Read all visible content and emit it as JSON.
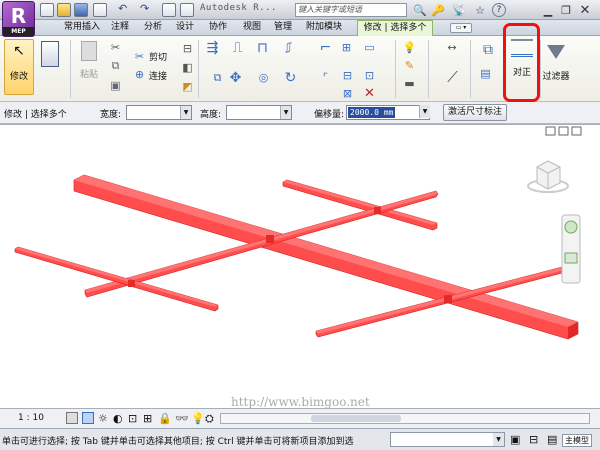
{
  "app": {
    "logo_letter": "R",
    "logo_sub": "MEP",
    "window_title": "Autodesk R...",
    "search_placeholder": "键入关键字或短语"
  },
  "tabs": [
    {
      "label": "常用"
    },
    {
      "label": "插入"
    },
    {
      "label": "注释"
    },
    {
      "label": "分析"
    },
    {
      "label": "设计"
    },
    {
      "label": "协作"
    },
    {
      "label": "视图"
    },
    {
      "label": "管理"
    },
    {
      "label": "附加模块"
    },
    {
      "label": "修改 | 选择多个"
    }
  ],
  "ribbon": {
    "modify_label": "修改",
    "paste_label": "粘贴",
    "cut_label": "剪切",
    "join_label": "连接",
    "align_label": "对正",
    "filter_label": "过滤器"
  },
  "options_bar": {
    "context_label": "修改 | 选择多个",
    "width_label": "宽度:",
    "height_label": "高度:",
    "offset_label": "偏移量:",
    "offset_value": "2000.0 mm",
    "activate_dim_label": "激活尺寸标注"
  },
  "viewport": {
    "watermark": "http://www.bimgoo.net",
    "duct_color": "#ff3b3b"
  },
  "view_toolbar": {
    "scale": "1 : 10"
  },
  "status": {
    "text": "单击可进行选择; 按 Tab 键并单击可选择其他项目; 按 Ctrl 键并单击可将新项目添加到选",
    "model_label": "主模型"
  }
}
